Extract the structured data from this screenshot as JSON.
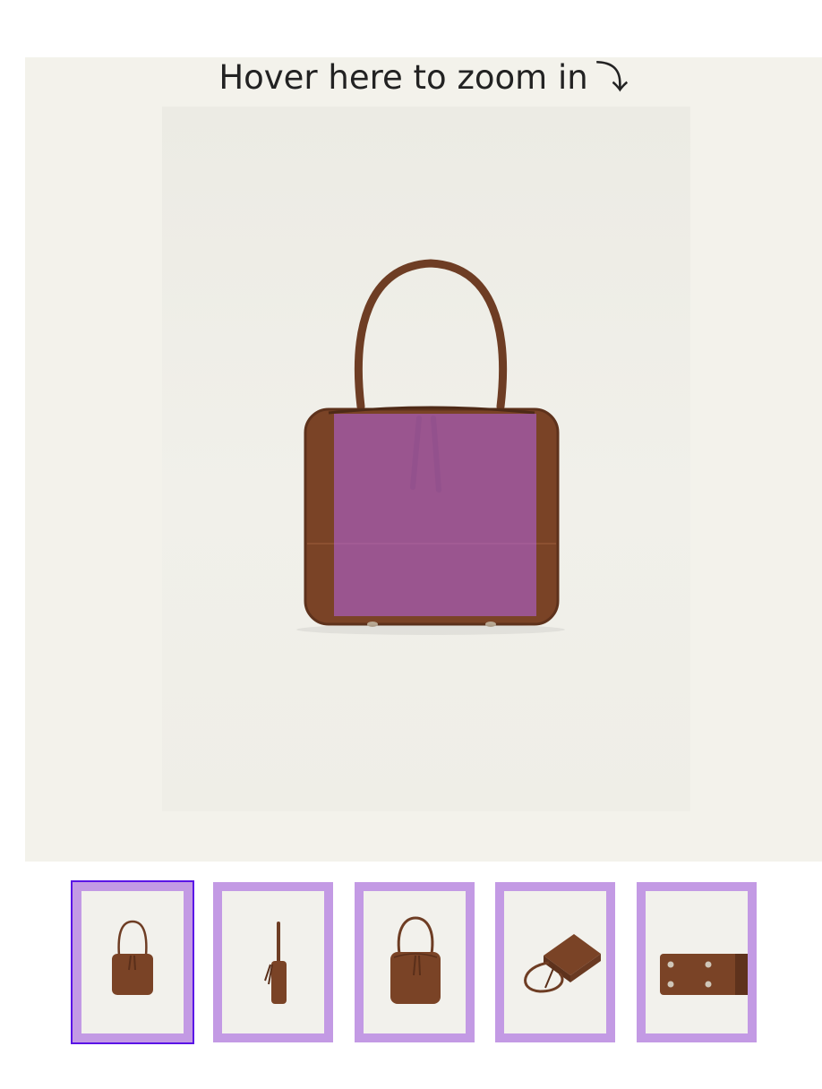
{
  "zoom_hint": {
    "text": "Hover here to zoom in",
    "arrow_icon": "⤵"
  },
  "main_image": {
    "subject": "brown suede square handbag with round top handle",
    "lens_color": "#b464e6"
  },
  "thumbnails": {
    "active_index": 0,
    "active_border_color": "#5a14e6",
    "border_color": "#c39ae4",
    "items": [
      {
        "view": "front"
      },
      {
        "view": "side"
      },
      {
        "view": "three-quarter"
      },
      {
        "view": "top-down open"
      },
      {
        "view": "bottom"
      }
    ]
  },
  "colors": {
    "stage_bg": "#f3f2eb",
    "leather": "#7a4326",
    "handle": "#6e3d24"
  }
}
